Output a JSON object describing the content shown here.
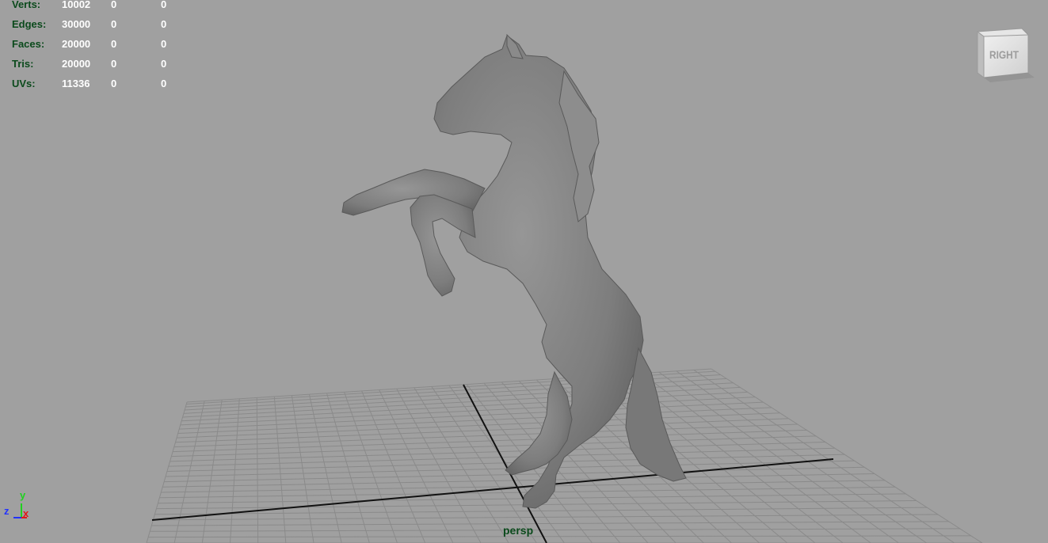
{
  "hud": {
    "rows": [
      {
        "label": "Verts:",
        "v1": "10002",
        "v2": "0",
        "v3": "0"
      },
      {
        "label": "Edges:",
        "v1": "30000",
        "v2": "0",
        "v3": "0"
      },
      {
        "label": "Faces:",
        "v1": "20000",
        "v2": "0",
        "v3": "0"
      },
      {
        "label": "Tris:",
        "v1": "20000",
        "v2": "0",
        "v3": "0"
      },
      {
        "label": "UVs:",
        "v1": "11336",
        "v2": "0",
        "v3": "0"
      }
    ]
  },
  "view_cube": {
    "face_label": "RIGHT"
  },
  "camera": {
    "name": "persp"
  },
  "axes": {
    "y": "y",
    "z": "z",
    "x": "x"
  },
  "colors": {
    "background": "#a0a0a0",
    "hud_label": "#0b4a1c",
    "hud_value": "#ffffff",
    "grid": "#8a8a8a",
    "grid_axis": "#111111",
    "model": "#7f7f7f"
  },
  "scene": {
    "model_icon": "rearing-horse-model"
  }
}
